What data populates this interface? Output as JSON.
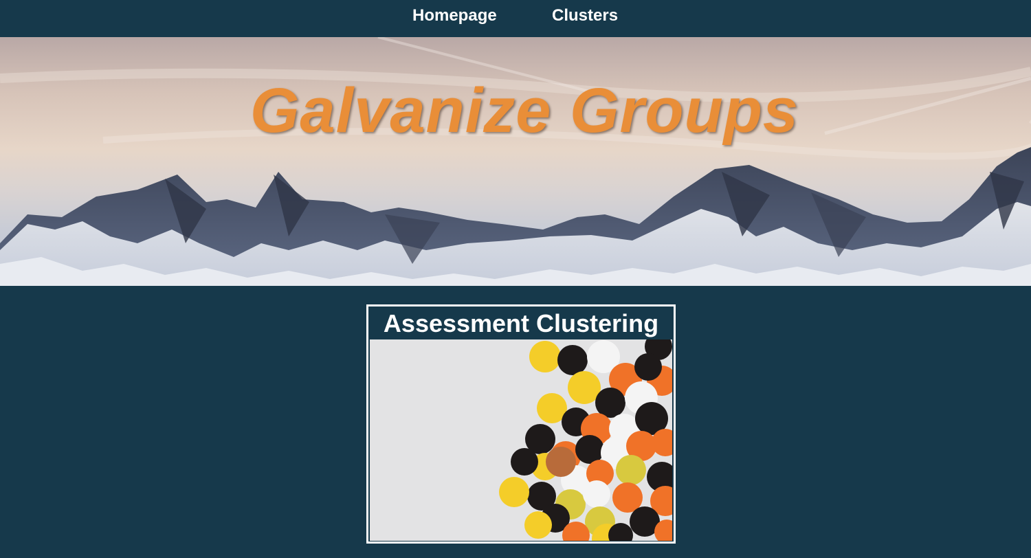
{
  "nav": {
    "items": [
      {
        "label": "Homepage"
      },
      {
        "label": "Clusters"
      }
    ]
  },
  "hero": {
    "title": "Galvanize Groups"
  },
  "card": {
    "title": "Assessment Clustering"
  },
  "colors": {
    "background": "#16394b",
    "title_orange": "#e98e38",
    "confetti": [
      "#1e1a1a",
      "#f07228",
      "#f4cd29",
      "#f4f4f4",
      "#d8c93f"
    ]
  }
}
